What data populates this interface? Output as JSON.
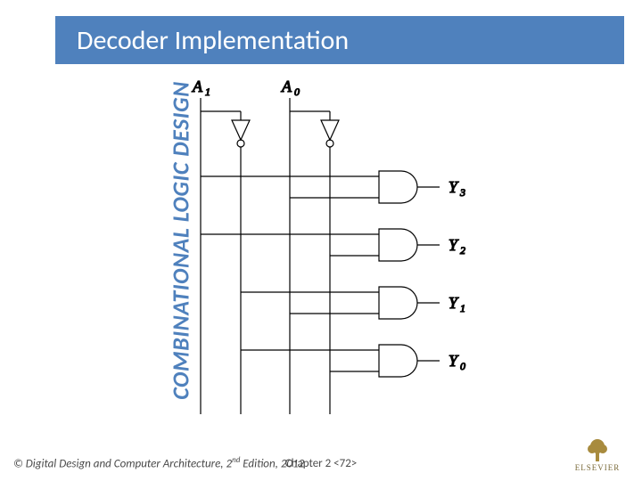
{
  "sidebar": {
    "label": "COMBINATIONAL LOGIC DESIGN"
  },
  "title": "Decoder Implementation",
  "inputs": {
    "a1": {
      "sym": "A",
      "sub": "1"
    },
    "a0": {
      "sym": "A",
      "sub": "0"
    }
  },
  "outputs": {
    "y3": {
      "sym": "Y",
      "sub": "3"
    },
    "y2": {
      "sym": "Y",
      "sub": "2"
    },
    "y1": {
      "sym": "Y",
      "sub": "1"
    },
    "y0": {
      "sym": "Y",
      "sub": "0"
    }
  },
  "footer": {
    "copyright_prefix": "© ",
    "book_title": "Digital Design and Computer Architecture",
    "edition_sep": ", ",
    "edition_num": "2",
    "edition_suffix": "nd",
    "edition_word": " Edition, 2012",
    "chapter": "Chapter 2 <72>",
    "publisher": "ELSEVIER"
  }
}
